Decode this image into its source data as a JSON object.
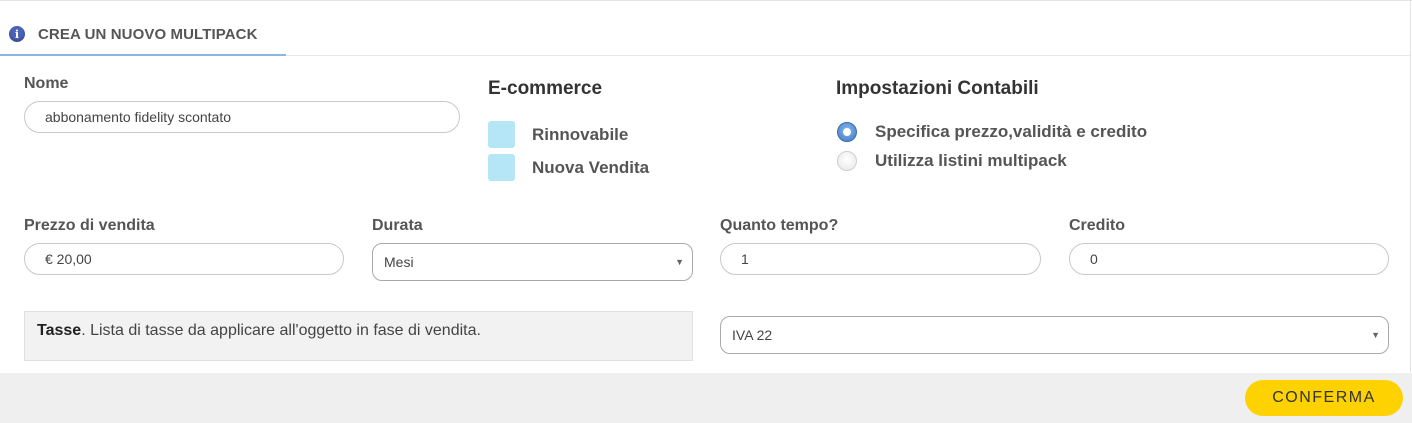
{
  "header": {
    "icon": "info-icon",
    "icon_glyph": "i",
    "title": "CREA UN NUOVO MULTIPACK"
  },
  "form": {
    "nome": {
      "label": "Nome",
      "value": "abbonamento fidelity scontato"
    },
    "ecommerce": {
      "title": "E-commerce",
      "options": [
        {
          "label": "Rinnovabile",
          "checked": false
        },
        {
          "label": "Nuova Vendita",
          "checked": false
        }
      ]
    },
    "impostazioni": {
      "title": "Impostazioni Contabili",
      "options": [
        {
          "label": "Specifica prezzo,validità e credito",
          "selected": true
        },
        {
          "label": "Utilizza listini multipack",
          "selected": false
        }
      ]
    },
    "prezzo": {
      "label": "Prezzo di vendita",
      "value": "€ 20,00"
    },
    "durata": {
      "label": "Durata",
      "value": "Mesi"
    },
    "quanto": {
      "label": "Quanto tempo?",
      "value": "1"
    },
    "credito": {
      "label": "Credito",
      "value": "0"
    },
    "tasse": {
      "bold": "Tasse",
      "text": ". Lista di tasse da applicare all'oggetto in fase di vendita.",
      "value": "IVA 22"
    }
  },
  "footer": {
    "confirm_label": "CONFERMA"
  },
  "colors": {
    "accent": "#fdd200",
    "checkbox": "#b4e6f5",
    "radio_selected": "#3a78c6",
    "tab_underline": "#8ab7e6"
  }
}
